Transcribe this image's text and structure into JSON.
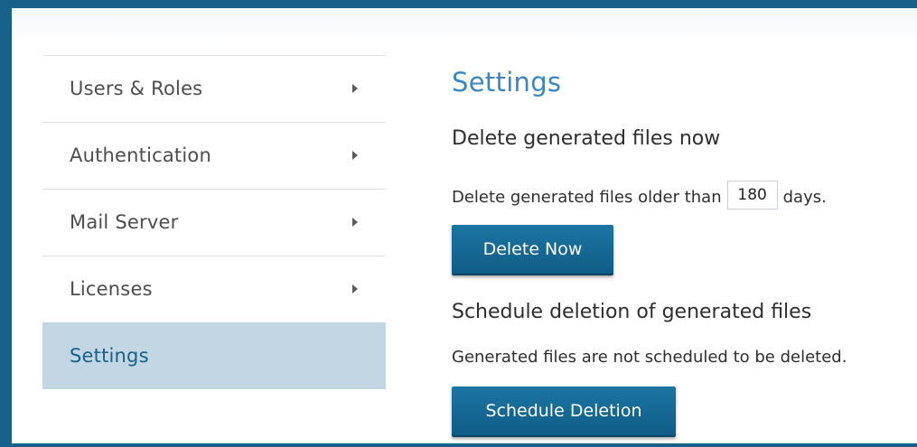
{
  "sidebar": {
    "items": [
      {
        "label": "Users & Roles"
      },
      {
        "label": "Authentication"
      },
      {
        "label": "Mail Server"
      },
      {
        "label": "Licenses"
      },
      {
        "label": "Settings"
      }
    ]
  },
  "main": {
    "title": "Settings",
    "delete_section": {
      "heading": "Delete generated files now",
      "text_before": "Delete generated files older than",
      "days_value": "180",
      "text_after": "days.",
      "button_label": "Delete Now"
    },
    "schedule_section": {
      "heading": "Schedule deletion of generated files",
      "status_text": "Generated files are not scheduled to be deleted.",
      "button_label": "Schedule Deletion"
    }
  },
  "colors": {
    "frame_border": "#17618a",
    "title_blue": "#3a86c2",
    "active_bg": "#c3d6e3",
    "button_bg": "#17618a"
  }
}
